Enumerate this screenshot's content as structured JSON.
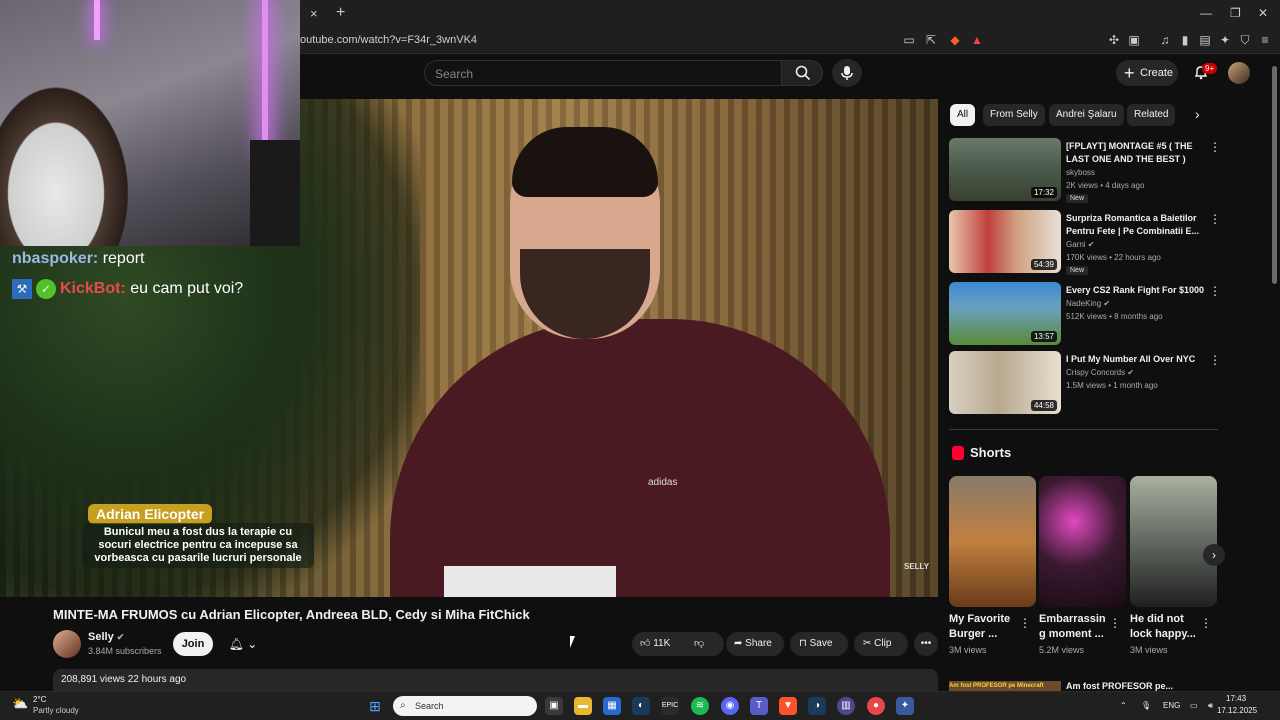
{
  "browser": {
    "url": "outube.com/watch?v=F34r_3wnVK4",
    "close_tab_glyph": "×",
    "new_tab_glyph": "+"
  },
  "header": {
    "search_placeholder": "Search",
    "create_label": "Create",
    "notifications_badge": "9+"
  },
  "chat": [
    {
      "user": "nbaspoker:",
      "message": "report"
    },
    {
      "user": "KickBot:",
      "message": "eu cam put voi?"
    }
  ],
  "video": {
    "subtitle_name": "Adrian Elicopter",
    "subtitle_text": "Bunicul meu a fost dus la terapie cu socuri electrice pentru ca incepuse sa vorbeasca cu pasarile lucruri personale",
    "watermark": "SELLY",
    "logo_text": "adidas"
  },
  "watch": {
    "title": "MINTE-MA FRUMOS cu Adrian Elicopter, Andreea BLD, Cedy si Miha FitChick",
    "channel_name": "Selly",
    "subscribers": "3.84M subscribers",
    "join_label": "Join",
    "like_count": "11K",
    "share_label": "Share",
    "save_label": "Save",
    "clip_label": "Clip",
    "views_date": "208,891 views  22 hours ago"
  },
  "chips": [
    "All",
    "From Selly",
    "Andrei Şalaru",
    "Related"
  ],
  "recommendations": [
    {
      "title": "[FPLAYT] MONTAGE #5 ( THE LAST ONE AND THE BEST )",
      "channel": "skyboss",
      "meta": "2K views • 4 days ago",
      "duration": "17:32",
      "badge": "New"
    },
    {
      "title": "Surpriza Romantica a Baietilor Pentru Fete | Pe Combinatii E...",
      "channel": "Garni",
      "meta": "170K views • 22 hours ago",
      "duration": "54:39",
      "badge": "New"
    },
    {
      "title": "Every CS2 Rank Fight For $1000",
      "channel": "NadeKing",
      "meta": "512K views • 8 months ago",
      "duration": "13:57",
      "badge": ""
    },
    {
      "title": "I Put My Number All Over NYC",
      "channel": "Crispy Concords",
      "meta": "1.5M views • 1 month ago",
      "duration": "44:58",
      "badge": ""
    }
  ],
  "shorts": {
    "heading": "Shorts",
    "items": [
      {
        "title": "My Favorite Burger ...",
        "views": "3M views"
      },
      {
        "title": "Embarrassin g moment ...",
        "views": "5.2M views"
      },
      {
        "title": "He did not lock happy...",
        "views": "3M views"
      }
    ]
  },
  "next_rec": {
    "title": "Am fost PROFESOR pe...",
    "thumb_text": "Am fost PROFESOR pe Minecraft"
  },
  "taskbar": {
    "temperature": "2°C",
    "condition": "Partly cloudy",
    "search_placeholder": "Search",
    "language": "ENG",
    "time": "17:43",
    "date": "17.12.2025"
  },
  "colors": {
    "yt_red": "#ff0033",
    "background": "#0f0f0f",
    "chip_bg": "#272727"
  }
}
